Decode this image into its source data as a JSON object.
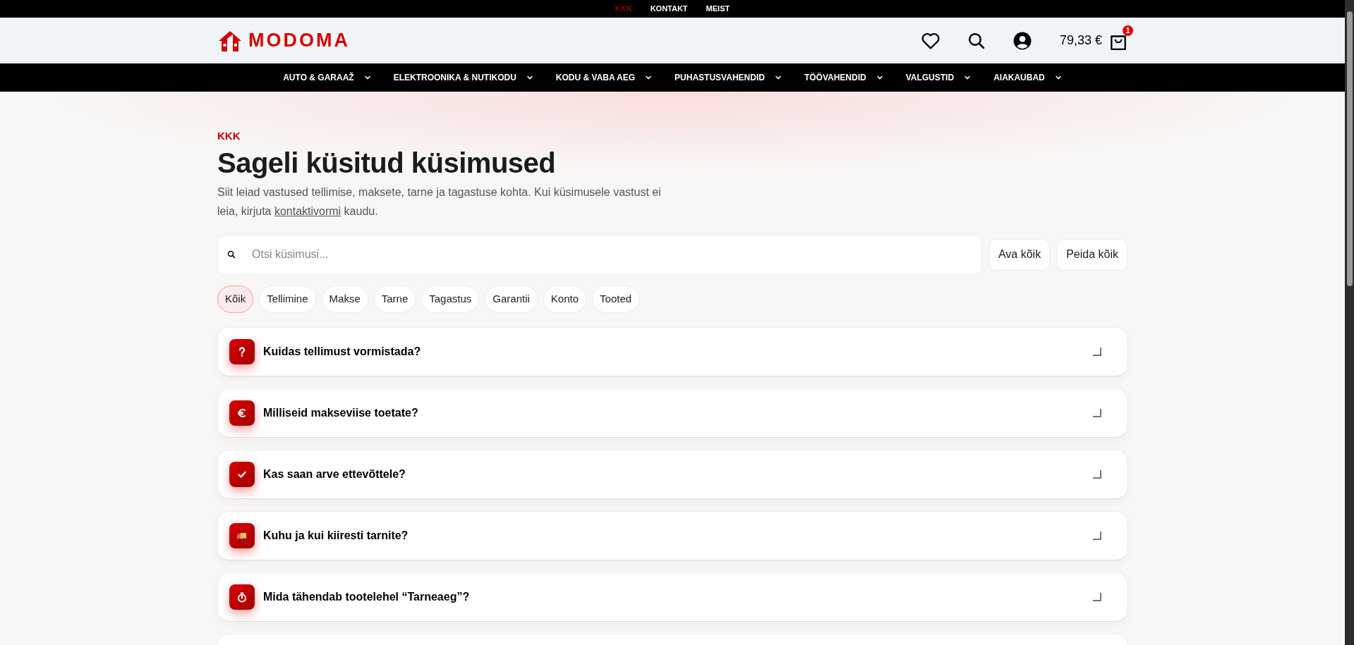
{
  "top_links": [
    {
      "label": "KKK",
      "selected": true
    },
    {
      "label": "KONTAKT",
      "selected": false
    },
    {
      "label": "MEIST",
      "selected": false
    }
  ],
  "header": {
    "logo": "MODOMA",
    "cart_total": "79,33 €",
    "cart_count": "1"
  },
  "nav": [
    {
      "label": "AUTO & GARAAŽ"
    },
    {
      "label": "ELEKTROONIKA & NUTIKODU"
    },
    {
      "label": "KODU & VABA AEG"
    },
    {
      "label": "PUHASTUSVAHENDID"
    },
    {
      "label": "TÖÖVAHENDID"
    },
    {
      "label": "VALGUSTID"
    },
    {
      "label": "AIAKAUBAD"
    }
  ],
  "page": {
    "eyebrow": "KKK",
    "title": "Sageli küsitud küsimused",
    "intro_before": "Siit leiad vastused tellimise, maksete, tarne ja tagastuse kohta. Kui küsimusele vastust ei leia, kirjuta ",
    "intro_link": "kontaktivormi",
    "intro_after": " kaudu."
  },
  "search": {
    "placeholder": "Otsi küsimusi..."
  },
  "buttons": [
    "Ava kõik",
    "Peida kõik"
  ],
  "filters": [
    {
      "label": "Kõik",
      "selected": true
    },
    {
      "label": "Tellimine",
      "selected": false
    },
    {
      "label": "Makse",
      "selected": false
    },
    {
      "label": "Tarne",
      "selected": false
    },
    {
      "label": "Tagastus",
      "selected": false
    },
    {
      "label": "Garantii",
      "selected": false
    },
    {
      "label": "Konto",
      "selected": false
    },
    {
      "label": "Tooted",
      "selected": false
    }
  ],
  "faq": [
    {
      "question": "Kuidas tellimust vormistada?",
      "kind": "question",
      "expanded": false
    },
    {
      "question": "Milliseid makseviise toetate?",
      "kind": "euro",
      "expanded": false
    },
    {
      "question": "Kas saan arve ettevõttele?",
      "kind": "check",
      "expanded": false
    },
    {
      "question": "Kuhu ja kui kiiresti tarnite?",
      "kind": "truck",
      "expanded": false
    },
    {
      "question": "Mida tähendab tootelehel “Tarneaeg”?",
      "kind": "timer",
      "expanded": false
    }
  ]
}
